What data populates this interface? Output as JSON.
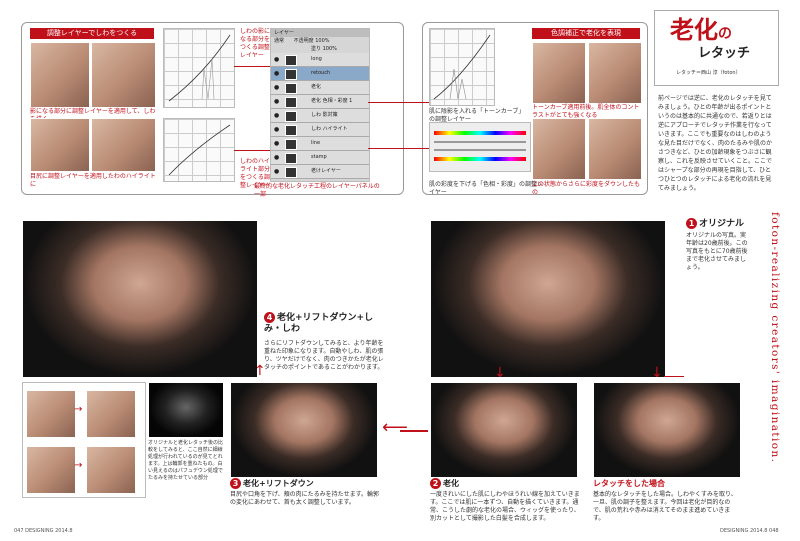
{
  "left_top": {
    "section_title": "調整レイヤーでしわをつくる",
    "cap1": "影になる部分に調整レイヤーを適用して、しわを描く",
    "cap2": "目尻に調整レイヤーを適用したわのハイライトに",
    "red_note1": "しわの影になる部分をつくる調整レイヤー",
    "red_note2": "しわのハイライト部分をつくる調整レイヤー",
    "layers_caption": "最終的な老化レタッチ工程のレイヤーパネルの一部"
  },
  "layers_panel": {
    "title": "レイヤー",
    "mode": "通常",
    "opacity_label": "不透明度",
    "opacity": "100%",
    "fill_label": "塗り",
    "fill": "100%",
    "rows": [
      "long",
      "retouch",
      "老化",
      "老化 色相・彩度 1",
      "しわ 影対策",
      "しわ ハイライト",
      "line",
      "stamp",
      "老けレイヤー"
    ]
  },
  "right_top": {
    "section_title": "色調補正で老化を表現",
    "cap_curve": "肌に陰影を入れる「トーンカーブ」の調整レイヤー",
    "cap_hue": "肌の彩度を下げる「色相・彩度」の調整レイヤー",
    "red_cap1": "トーンカーブ適用前後。肌全体のコントラストがとても強くなる",
    "red_cap2": "上の状態からさらに彩度をダウンしたもの"
  },
  "title_box": {
    "title_main": "老化",
    "title_no": "の",
    "title_sub": "レタッチ",
    "credit": "レタッチ＝西山 淳（foton）"
  },
  "intro_text": "前ページでは逆に、老化のレタッチを見てみましょう。ひとの年齢が出るポイントというのは基本的に共通なので、若返りとは逆にアプローチでレタッチ作業を行なっていきます。ここでも重要なのはしわのような見た目だけでなく、肉のたるみや肌のかさつきなど、ひとの加齢現象をつぶさに観察し、これを反映させていくこと。ここではシャープな部分の再現を目指して、ひとつひとつのレタッチによる老化の流れを見てみましょう。",
  "vertical_text": "foton-realizing creators' imagination.",
  "step1": {
    "num": "1",
    "title": "オリジナル",
    "text": "オリジナルの写真。実年齢は20歳前後。この写真をもとに70歳前後まで老化させてみましょう。"
  },
  "step4": {
    "num": "4",
    "title": "老化+リフトダウン+しみ・しわ",
    "text": "さらにリフトダウンしてみると、より年齢を重ねた印象になります。自動やしわ、肌の張り、ツヤだけでなく、肉のつきかたが老化レタッチのポイントであることがわかります。"
  },
  "step3": {
    "num": "3",
    "title": "老化+リフトダウン",
    "text": "目尻や口角を下げ、頬の肉にたるみを持たせます。輪郭の変化にあわせて、首も太く調整しています。"
  },
  "step2": {
    "num": "2",
    "title": "老化",
    "text": "一度きれいにした肌にしわやほうれい線を加えていきます。ここでは肌に一本ずつ、自動を描くていきます。通常、こうした劇的な老化の場合、ウィッグを使ったり、別カットとして撮影した白髪を合成します。"
  },
  "retouched": {
    "title": "レタッチをした場合",
    "text": "基本的なレタッチをした場合。しわやくすみを取り、一旦、肌の調子を整えます。今回は老化が目的なので、肌の荒れや赤みは消えてそのまま進めていきます。"
  },
  "bottom_left_cap": "オリジナルと老化レタッチ後の比較をしてみると、ここ自然に細線処理が行われているのが見てとれます。上は輪郭を重ねたもの。白い見えるのはパフュデウン処理でたるみを持たせている部分",
  "footer": {
    "left": "047 DESIGNING 2014.8",
    "right": "DESIGNING 2014.8 048"
  }
}
